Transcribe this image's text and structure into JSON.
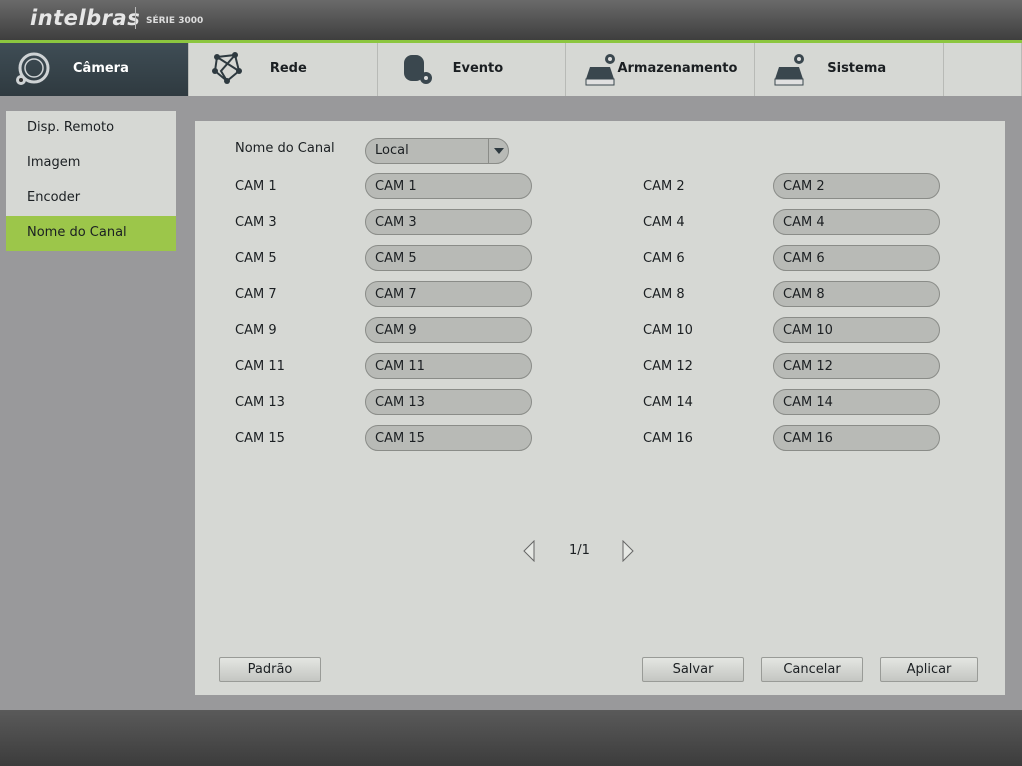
{
  "header": {
    "brand": "intelbras",
    "series": "SÉRIE 3000"
  },
  "tabs": [
    {
      "label": "Câmera",
      "icon": "camera-gear-icon",
      "active": true
    },
    {
      "label": "Rede",
      "icon": "network-icon"
    },
    {
      "label": "Evento",
      "icon": "event-icon"
    },
    {
      "label": "Armazenamento",
      "icon": "storage-icon"
    },
    {
      "label": "Sistema",
      "icon": "system-icon"
    }
  ],
  "sidebar": {
    "items": [
      {
        "label": "Disp. Remoto"
      },
      {
        "label": "Imagem"
      },
      {
        "label": "Encoder"
      },
      {
        "label": "Nome do Canal",
        "active": true
      }
    ]
  },
  "main": {
    "channel_name_label": "Nome do Canal",
    "channel_source": "Local",
    "channels": [
      {
        "label": "CAM 1",
        "value": "CAM 1"
      },
      {
        "label": "CAM 2",
        "value": "CAM 2"
      },
      {
        "label": "CAM 3",
        "value": "CAM 3"
      },
      {
        "label": "CAM 4",
        "value": "CAM 4"
      },
      {
        "label": "CAM 5",
        "value": "CAM 5"
      },
      {
        "label": "CAM 6",
        "value": "CAM 6"
      },
      {
        "label": "CAM 7",
        "value": "CAM 7"
      },
      {
        "label": "CAM 8",
        "value": "CAM 8"
      },
      {
        "label": "CAM 9",
        "value": "CAM 9"
      },
      {
        "label": "CAM 10",
        "value": "CAM 10"
      },
      {
        "label": "CAM 11",
        "value": "CAM 11"
      },
      {
        "label": "CAM 12",
        "value": "CAM 12"
      },
      {
        "label": "CAM 13",
        "value": "CAM 13"
      },
      {
        "label": "CAM 14",
        "value": "CAM 14"
      },
      {
        "label": "CAM 15",
        "value": "CAM 15"
      },
      {
        "label": "CAM 16",
        "value": "CAM 16"
      }
    ],
    "page": "1/1",
    "buttons": {
      "default": "Padrão",
      "save": "Salvar",
      "cancel": "Cancelar",
      "apply": "Aplicar"
    }
  },
  "colors": {
    "accent": "#8cc63f",
    "active_tab": "#3f4d55",
    "active_sidebar": "#9cc64a"
  }
}
